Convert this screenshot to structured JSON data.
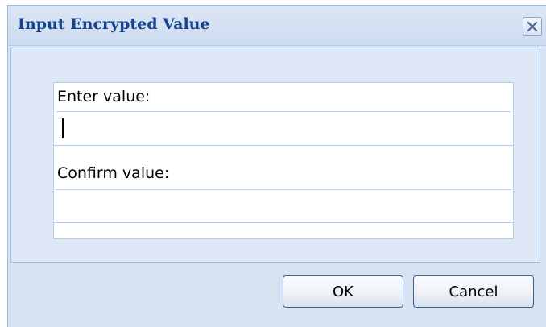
{
  "dialog": {
    "title": "Input Encrypted Value",
    "close_icon": "close-icon"
  },
  "form": {
    "enter_label": "Enter value:",
    "enter_value": "",
    "confirm_label": "Confirm value:",
    "confirm_value": ""
  },
  "buttons": {
    "ok_label": "OK",
    "cancel_label": "Cancel"
  },
  "colors": {
    "title_text": "#15428b",
    "dialog_bg": "#d7e2f2",
    "panel_border": "#99bbe8"
  }
}
